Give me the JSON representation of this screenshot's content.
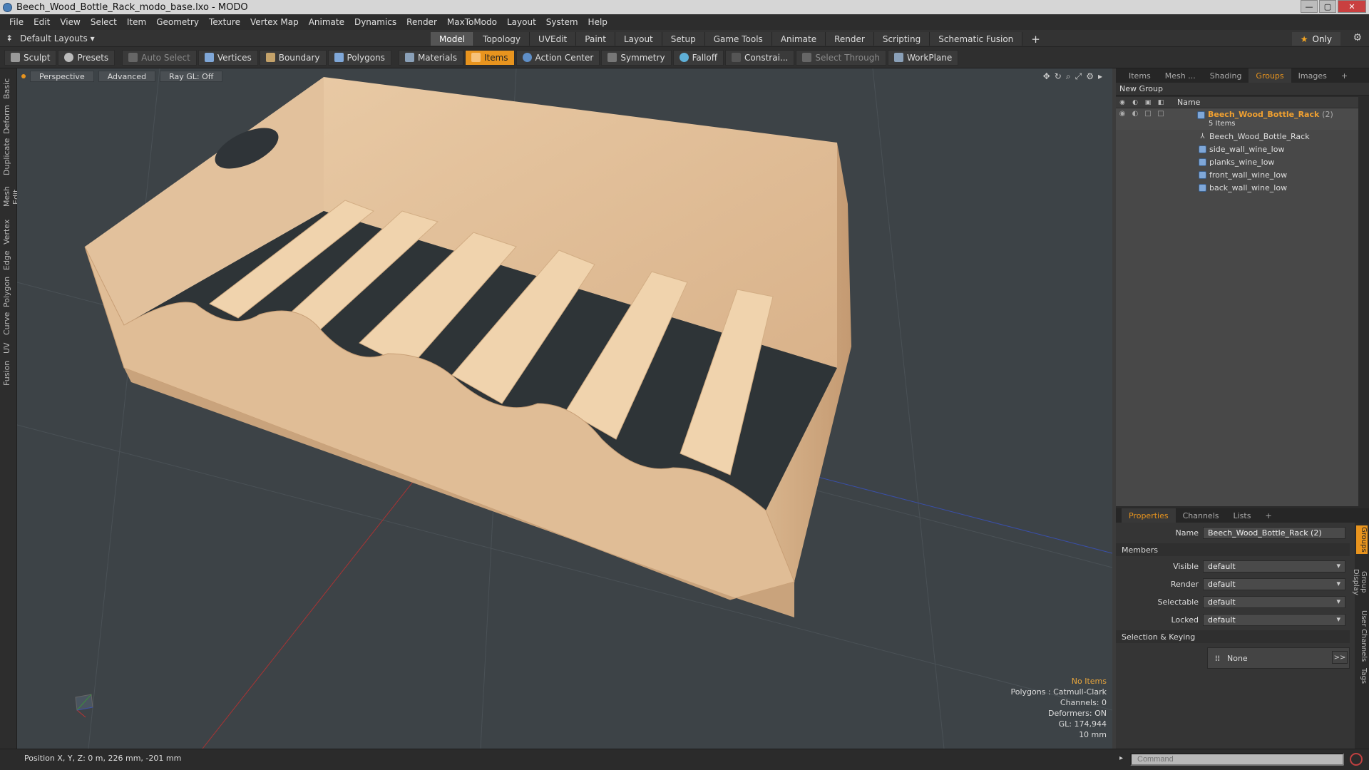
{
  "window": {
    "title": "Beech_Wood_Bottle_Rack_modo_base.lxo - MODO",
    "min": "—",
    "max": "▢",
    "close": "✕"
  },
  "menu": [
    "File",
    "Edit",
    "View",
    "Select",
    "Item",
    "Geometry",
    "Texture",
    "Vertex Map",
    "Animate",
    "Dynamics",
    "Render",
    "MaxToModo",
    "Layout",
    "System",
    "Help"
  ],
  "layout_selector": "Default Layouts ▾",
  "main_tabs": [
    "Model",
    "Topology",
    "UVEdit",
    "Paint",
    "Layout",
    "Setup",
    "Game Tools",
    "Animate",
    "Render",
    "Scripting",
    "Schematic Fusion"
  ],
  "only_label": "Only",
  "toolbar": {
    "sculpt": "Sculpt",
    "presets": "Presets",
    "auto_select": "Auto Select",
    "vertices": "Vertices",
    "boundary": "Boundary",
    "polygons": "Polygons",
    "materials": "Materials",
    "items": "Items",
    "action_center": "Action Center",
    "symmetry": "Symmetry",
    "falloff": "Falloff",
    "constraints": "Constrai...",
    "select_through": "Select Through",
    "workplane": "WorkPlane"
  },
  "left_tabs": [
    "Basic",
    "Deform",
    "Duplicate",
    "Mesh Edit",
    "Vertex",
    "Edge",
    "Polygon",
    "Curve",
    "UV",
    "Fusion"
  ],
  "viewport": {
    "perspective": "Perspective",
    "advanced": "Advanced",
    "raygl": "Ray GL: Off",
    "stats": {
      "no_items": "No Items",
      "polygons": "Polygons : Catmull-Clark",
      "channels": "Channels: 0",
      "deformers": "Deformers: ON",
      "gl": "GL: 174,944",
      "scale": "10 mm"
    }
  },
  "right_tabs": [
    "Items",
    "Mesh ...",
    "Shading",
    "Groups",
    "Images"
  ],
  "groups": {
    "new_group": "New Group",
    "col_name": "Name",
    "group_name": "Beech_Wood_Bottle_Rack",
    "group_suffix": "(2)",
    "group_count": "5 Items",
    "items": [
      "Beech_Wood_Bottle_Rack",
      "side_wall_wine_low",
      "planks_wine_low",
      "front_wall_wine_low",
      "back_wall_wine_low"
    ]
  },
  "props_tabs": [
    "Properties",
    "Channels",
    "Lists"
  ],
  "properties": {
    "name_label": "Name",
    "name_value": "Beech_Wood_Bottle_Rack (2)",
    "members": "Members",
    "rows": [
      {
        "label": "Visible",
        "value": "default"
      },
      {
        "label": "Render",
        "value": "default"
      },
      {
        "label": "Selectable",
        "value": "default"
      },
      {
        "label": "Locked",
        "value": "default"
      }
    ],
    "selection_keying": "Selection & Keying",
    "none": "None",
    "expand": ">>"
  },
  "side_vtabs": [
    "Groups",
    "Group Display",
    "User Channels",
    "Tags"
  ],
  "status": {
    "position": "Position X, Y, Z:  0 m, 226 mm, -201 mm"
  },
  "command": {
    "placeholder": "Command"
  }
}
